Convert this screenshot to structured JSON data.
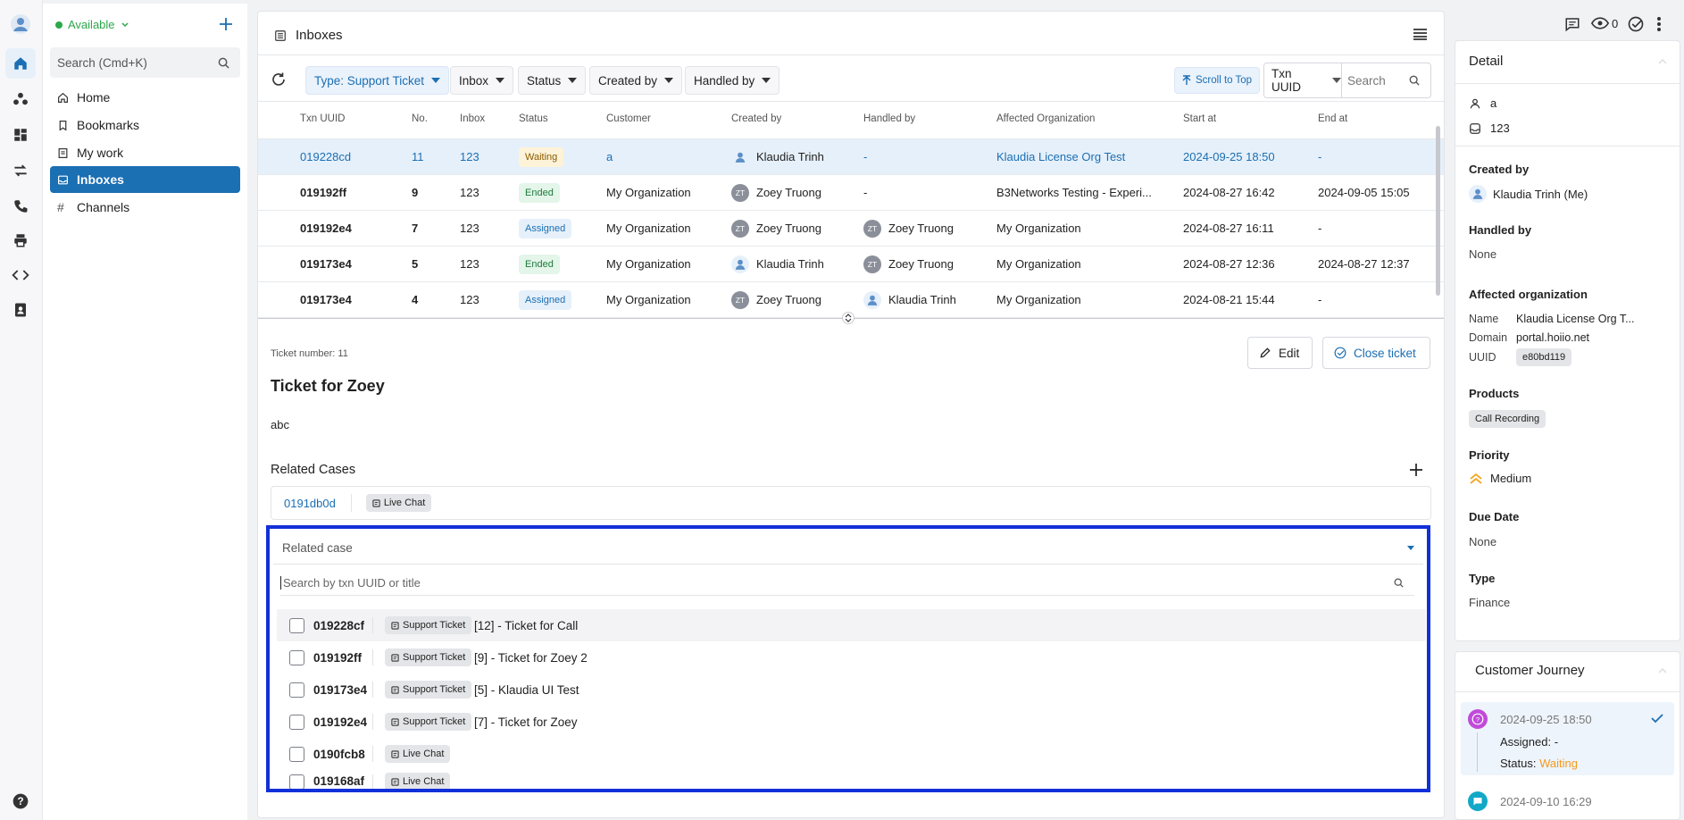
{
  "left_nav": {
    "status_label": "Available",
    "search_placeholder": "Search (Cmd+K)",
    "items": [
      {
        "label": "Home"
      },
      {
        "label": "Bookmarks"
      },
      {
        "label": "My work"
      },
      {
        "label": "Inboxes"
      },
      {
        "label": "Channels"
      }
    ]
  },
  "header": {
    "title": "Inboxes",
    "watch_count": "0"
  },
  "filters": {
    "type": "Type: Support Ticket",
    "inbox": "Inbox",
    "status": "Status",
    "created_by": "Created by",
    "handled_by": "Handled by",
    "scroll_top": "Scroll to Top",
    "search_field": "Txn UUID",
    "search_placeholder": "Search"
  },
  "table": {
    "columns": [
      "Txn UUID",
      "No.",
      "Inbox",
      "Status",
      "Customer",
      "Created by",
      "Handled by",
      "Affected Organization",
      "Start at",
      "End at"
    ],
    "rows": [
      {
        "uuid": "019228cd",
        "no": "11",
        "inbox": "123",
        "status": "Waiting",
        "status_kind": "waiting",
        "customer": "a",
        "created_by": "Klaudia Trinh",
        "created_av": "person",
        "handled_by": "-",
        "handled_av": "",
        "org": "Klaudia License Org Test",
        "start": "2024-09-25 18:50",
        "end": "-"
      },
      {
        "uuid": "019192ff",
        "no": "9",
        "inbox": "123",
        "status": "Ended",
        "status_kind": "ended",
        "customer": "My Organization",
        "created_by": "Zoey Truong",
        "created_av": "ZT",
        "handled_by": "-",
        "handled_av": "",
        "org": "B3Networks Testing - Experi...",
        "start": "2024-08-27 16:42",
        "end": "2024-09-05 15:05"
      },
      {
        "uuid": "019192e4",
        "no": "7",
        "inbox": "123",
        "status": "Assigned",
        "status_kind": "assigned",
        "customer": "My Organization",
        "created_by": "Zoey Truong",
        "created_av": "ZT",
        "handled_by": "Zoey Truong",
        "handled_av": "ZT",
        "org": "My Organization",
        "start": "2024-08-27 16:11",
        "end": "-"
      },
      {
        "uuid": "019173e4",
        "no": "5",
        "inbox": "123",
        "status": "Ended",
        "status_kind": "ended",
        "customer": "My Organization",
        "created_by": "Klaudia Trinh",
        "created_av": "person",
        "handled_by": "Zoey Truong",
        "handled_av": "ZT",
        "org": "My Organization",
        "start": "2024-08-27 12:36",
        "end": "2024-08-27 12:37"
      },
      {
        "uuid": "019173e4",
        "no": "4",
        "inbox": "123",
        "status": "Assigned",
        "status_kind": "assigned",
        "customer": "My Organization",
        "created_by": "Zoey Truong",
        "created_av": "ZT",
        "handled_by": "Klaudia Trinh",
        "handled_av": "person",
        "org": "My Organization",
        "start": "2024-08-21 15:44",
        "end": "-"
      }
    ]
  },
  "ticket": {
    "number_label": "Ticket number: 11",
    "title": "Ticket for Zoey",
    "description": "abc",
    "edit_label": "Edit",
    "close_label": "Close ticket"
  },
  "related": {
    "heading": "Related Cases",
    "case_id": "0191db0d",
    "case_chip": "Live Chat",
    "select_placeholder": "Related case",
    "search_placeholder": "Search by txn UUID or title",
    "options": [
      {
        "id": "019228cf",
        "chip": "Support Ticket",
        "title": "[12] - Ticket for Call"
      },
      {
        "id": "019192ff",
        "chip": "Support Ticket",
        "title": "[9] - Ticket for Zoey 2"
      },
      {
        "id": "019173e4",
        "chip": "Support Ticket",
        "title": "[5] - Klaudia UI Test"
      },
      {
        "id": "019192e4",
        "chip": "Support Ticket",
        "title": "[7] - Ticket for Zoey"
      },
      {
        "id": "0190fcb8",
        "chip": "Live Chat",
        "title": ""
      },
      {
        "id": "019168af",
        "chip": "Live Chat",
        "title": ""
      }
    ]
  },
  "detail": {
    "title": "Detail",
    "customer": "a",
    "inbox": "123",
    "created_by_label": "Created by",
    "created_by": "Klaudia Trinh (Me)",
    "handled_by_label": "Handled by",
    "handled_by": "None",
    "affected_org_label": "Affected organization",
    "name_key": "Name",
    "name_val": "Klaudia License Org T...",
    "domain_key": "Domain",
    "domain_val": "portal.hoiio.net",
    "uuid_key": "UUID",
    "uuid_val": "e80bd119",
    "products_label": "Products",
    "product": "Call Recording",
    "priority_label": "Priority",
    "priority": "Medium",
    "due_label": "Due Date",
    "due": "None",
    "type_label": "Type",
    "type": "Finance"
  },
  "journey": {
    "title": "Customer Journey",
    "entries": [
      {
        "time": "2024-09-25 18:50",
        "assigned": "Assigned: -",
        "status_prefix": "Status:",
        "status": "Waiting"
      },
      {
        "time": "2024-09-10 16:29"
      }
    ]
  },
  "colors": {
    "accent": "#1b6fb3",
    "highlight_outline": "#1230d8",
    "waiting": "#f39a1e",
    "available": "#2ca84a"
  }
}
